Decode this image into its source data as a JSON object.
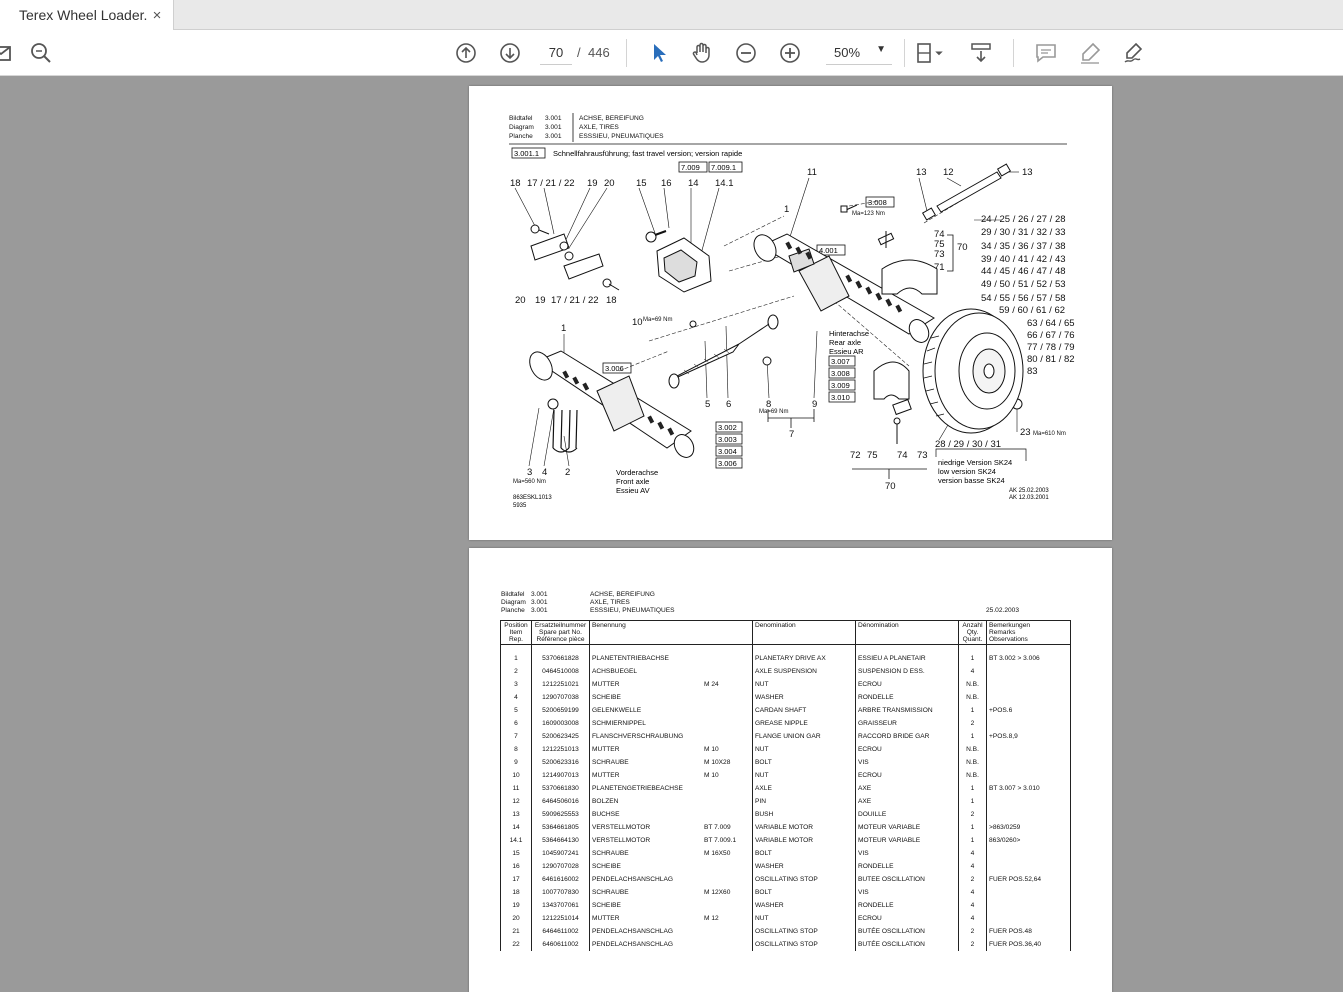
{
  "tab": {
    "title": "Terex Wheel Loader...",
    "close": "×"
  },
  "toolbar": {
    "page_current": "70",
    "page_separator": "/",
    "page_total": "446",
    "zoom": "50%"
  },
  "colors": {
    "accent": "#2a6ebb",
    "background": "#9a9a9a",
    "page": "#ffffff"
  },
  "diagram": {
    "header": {
      "rows": [
        {
          "label": "Bildtafel",
          "num": "3.001",
          "desc": "ACHSE, BEREIFUNG"
        },
        {
          "label": "Diagram",
          "num": "3.001",
          "desc": "AXLE, TIRES"
        },
        {
          "label": "Planche",
          "num": "3.001",
          "desc": "ESSSIEU, PNEUMATIQUES"
        }
      ]
    },
    "fast_box": "3.001.1",
    "fast_text": "Schnellfahrausführung;  fast  travel  version;  version  rapide",
    "box_7009": "7.009",
    "box_70091": "7.009.1",
    "box_3008": "3.008",
    "box_4001": "4.001",
    "box_3006": "3.006",
    "ma_123": "Ma=123  Nm",
    "ma_69a": "Ma=69  Nm",
    "ma_69b": "Ma=69  Nm",
    "ma_560": "Ma=560  Nm",
    "ma_610": "Ma=610  Nm",
    "rear_boxes": [
      "3.007",
      "3.008",
      "3.009",
      "3.010"
    ],
    "front_boxes": [
      "3.002",
      "3.003",
      "3.004",
      "3.006"
    ],
    "rear_axle": [
      "Hinterachse",
      "Rear  axle",
      "Essieu  AR"
    ],
    "front_axle": [
      "Vorderachse",
      "Front  axle",
      "Essieu  AV"
    ],
    "low_version": [
      "niedrige  Version  SK24",
      "low  version  SK24",
      "version  basse  SK24"
    ],
    "ak_dates": [
      "AK  25.02.2003",
      "AK  12.03.2001"
    ],
    "doc_code": [
      "863ESKL1013",
      "5935"
    ],
    "tire_labels": [
      "24 / 25 / 26 / 27 / 28",
      "29 / 30 / 31 / 32 / 33",
      "34 / 35 / 36 / 37 / 38",
      "39 / 40 / 41 / 42 / 43",
      "44 / 45 / 46 / 47 / 48",
      "49 / 50 / 51 / 52 / 53",
      "54 / 55 / 56 / 57 / 58",
      "59 / 60 / 61 / 62",
      "63 / 64 / 65",
      "66 / 67 / 76",
      "77 / 78 / 79",
      "80 / 81 / 82",
      "83"
    ],
    "labels": {
      "l18a": "18",
      "l17a": "17 / 21 / 22",
      "l19a": "19",
      "l20a": "20",
      "l15": "15",
      "l16": "16",
      "l14": "14",
      "l141": "14.1",
      "l11": "11",
      "l13a": "13",
      "l12": "12",
      "l13b": "13",
      "l1a": "1",
      "l74a": "74",
      "l75a": "75",
      "l73a": "73",
      "l71": "71",
      "l70a": "70",
      "l20b": "20",
      "l19b": "19",
      "l17b": "17 / 21 / 22",
      "l18b": "18",
      "l10": "10",
      "l1b": "1",
      "l5": "5",
      "l6": "6",
      "l8": "8",
      "l9": "9",
      "l7": "7",
      "l3": "3",
      "l4": "4",
      "l2": "2",
      "l72": "72",
      "l75b": "75",
      "l74b": "74",
      "l73b": "73",
      "l70b": "70",
      "l23": "23",
      "l28": "28 / 29 / 30 / 31"
    }
  },
  "parts_list": {
    "header": {
      "rows": [
        {
          "label": "Bildtafel",
          "num": "3.001",
          "desc": "ACHSE, BEREIFUNG"
        },
        {
          "label": "Diagram",
          "num": "3.001",
          "desc": "AXLE, TIRES"
        },
        {
          "label": "Planche",
          "num": "3.001",
          "desc": "ESSSIEU, PNEUMATIQUES"
        }
      ],
      "date": "25.02.2003"
    },
    "columns": [
      [
        "Position",
        "Item",
        "Rep."
      ],
      [
        "Ersatzteilnummer",
        "Spare part No.",
        "Référence pièce"
      ],
      [
        "Benennung"
      ],
      [
        "Denomination"
      ],
      [
        "Dénomination"
      ],
      [
        "Anzahl",
        "Qty.",
        "Quant."
      ],
      [
        "Bemerkungen",
        "Remarks",
        "Observations"
      ]
    ],
    "rows": [
      {
        "pos": "1",
        "part": "5370661828",
        "de": "PLANETENTRIEBACHSE",
        "spec": "",
        "en": "PLANETARY DRIVE AX",
        "fr": "ESSIEU A PLANETAIR",
        "qty": "1",
        "rem": "BT 3.002 > 3.006"
      },
      {
        "pos": "2",
        "part": "0464510008",
        "de": "ACHSBUEGEL",
        "spec": "",
        "en": "AXLE SUSPENSION",
        "fr": "SUSPENSION D ESS.",
        "qty": "4",
        "rem": ""
      },
      {
        "pos": "3",
        "part": "1212251021",
        "de": "MUTTER",
        "spec": "M 24",
        "en": "NUT",
        "fr": "ECROU",
        "qty": "N.B.",
        "rem": ""
      },
      {
        "pos": "4",
        "part": "1290707038",
        "de": "SCHEIBE",
        "spec": "",
        "en": "WASHER",
        "fr": "RONDELLE",
        "qty": "N.B.",
        "rem": ""
      },
      {
        "pos": "5",
        "part": "5200659199",
        "de": "GELENKWELLE",
        "spec": "",
        "en": "CARDAN SHAFT",
        "fr": "ARBRE TRANSMISSION",
        "qty": "1",
        "rem": "+POS.6"
      },
      {
        "pos": "6",
        "part": "1609003008",
        "de": "SCHMIERNIPPEL",
        "spec": "",
        "en": "GREASE NIPPLE",
        "fr": "GRAISSEUR",
        "qty": "2",
        "rem": ""
      },
      {
        "pos": "7",
        "part": "5200623425",
        "de": "FLANSCHVERSCHRAUBUNG",
        "spec": "",
        "en": "FLANGE UNION GAR",
        "fr": "RACCORD BRIDE GAR",
        "qty": "1",
        "rem": "+POS.8,9"
      },
      {
        "pos": "8",
        "part": "1212251013",
        "de": "MUTTER",
        "spec": "M 10",
        "en": "NUT",
        "fr": "ECROU",
        "qty": "N.B.",
        "rem": ""
      },
      {
        "pos": "9",
        "part": "5200623316",
        "de": "SCHRAUBE",
        "spec": "M 10X28",
        "en": "BOLT",
        "fr": "VIS",
        "qty": "N.B.",
        "rem": ""
      },
      {
        "pos": "10",
        "part": "1214907013",
        "de": "MUTTER",
        "spec": "M 10",
        "en": "NUT",
        "fr": "ECROU",
        "qty": "N.B.",
        "rem": ""
      },
      {
        "pos": "11",
        "part": "5370661830",
        "de": "PLANETENGETRIEBEACHSE",
        "spec": "",
        "en": "AXLE",
        "fr": "AXE",
        "qty": "1",
        "rem": "BT 3.007 > 3.010"
      },
      {
        "pos": "12",
        "part": "6464506016",
        "de": "BOLZEN",
        "spec": "",
        "en": "PIN",
        "fr": "AXE",
        "qty": "1",
        "rem": ""
      },
      {
        "pos": "13",
        "part": "5909625553",
        "de": "BUCHSE",
        "spec": "",
        "en": "BUSH",
        "fr": "DOUILLE",
        "qty": "2",
        "rem": ""
      },
      {
        "pos": "14",
        "part": "5364661805",
        "de": "VERSTELLMOTOR",
        "spec": "BT 7.009",
        "en": "VARIABLE MOTOR",
        "fr": "MOTEUR VARIABLE",
        "qty": "1",
        "rem": ">863/0259"
      },
      {
        "pos": "14.1",
        "part": "5364664130",
        "de": "VERSTELLMOTOR",
        "spec": "BT 7.009.1",
        "en": "VARIABLE MOTOR",
        "fr": "MOTEUR VARIABLE",
        "qty": "1",
        "rem": "863/0260>"
      },
      {
        "pos": "15",
        "part": "1045907241",
        "de": "SCHRAUBE",
        "spec": "M 16X50",
        "en": "BOLT",
        "fr": "VIS",
        "qty": "4",
        "rem": ""
      },
      {
        "pos": "16",
        "part": "1290707028",
        "de": "SCHEIBE",
        "spec": "",
        "en": "WASHER",
        "fr": "RONDELLE",
        "qty": "4",
        "rem": ""
      },
      {
        "pos": "17",
        "part": "6461616002",
        "de": "PENDELACHSANSCHLAG",
        "spec": "",
        "en": "OSCILLATING STOP",
        "fr": "BUTEE OSCILLATION",
        "qty": "2",
        "rem": "FUER POS.52,64"
      },
      {
        "pos": "18",
        "part": "1007707830",
        "de": "SCHRAUBE",
        "spec": "M 12X60",
        "en": "BOLT",
        "fr": "VIS",
        "qty": "4",
        "rem": ""
      },
      {
        "pos": "19",
        "part": "1343707061",
        "de": "SCHEIBE",
        "spec": "",
        "en": "WASHER",
        "fr": "RONDELLE",
        "qty": "4",
        "rem": ""
      },
      {
        "pos": "20",
        "part": "1212251014",
        "de": "MUTTER",
        "spec": "M 12",
        "en": "NUT",
        "fr": "ECROU",
        "qty": "4",
        "rem": ""
      },
      {
        "pos": "21",
        "part": "6464611002",
        "de": "PENDELACHSANSCHLAG",
        "spec": "",
        "en": "OSCILLATING STOP",
        "fr": "BUTÉE OSCILLATION",
        "qty": "2",
        "rem": "FUER POS.48"
      },
      {
        "pos": "22",
        "part": "6460611002",
        "de": "PENDELACHSANSCHLAG",
        "spec": "",
        "en": "OSCILLATING STOP",
        "fr": "BUTÉE OSCILLATION",
        "qty": "2",
        "rem": "FUER POS.36,40"
      }
    ]
  }
}
